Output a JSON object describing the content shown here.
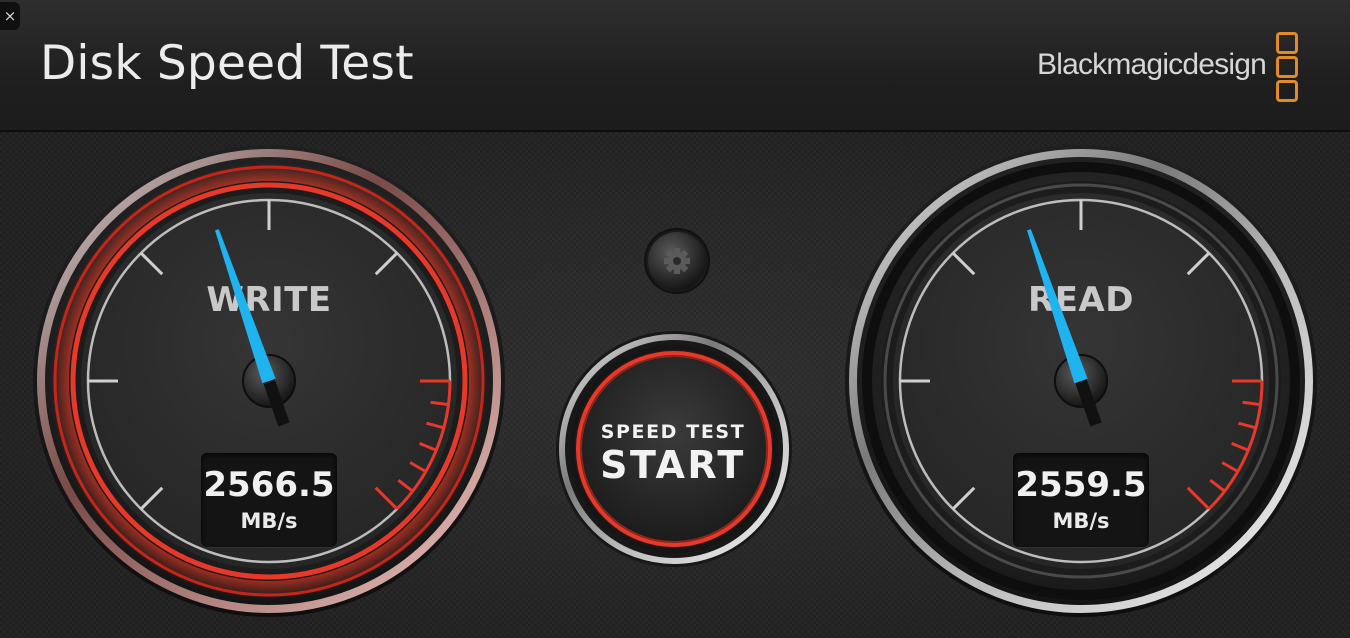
{
  "window": {
    "close_icon": "close-icon",
    "close_glyph": "×"
  },
  "header": {
    "title": "Disk Speed Test",
    "brand": "Blackmagicdesign",
    "brand_color": "#e08a2c"
  },
  "settings": {
    "icon": "gear-icon"
  },
  "start_button": {
    "line1": "SPEED TEST",
    "line2": "START",
    "ring_color": "#e23a2a"
  },
  "gauges": {
    "write": {
      "label": "WRITE",
      "value": "2566.5",
      "unit": "MB/s",
      "needle_color": "#1fb4f0",
      "active_ring_color": "#e23a2a"
    },
    "read": {
      "label": "READ",
      "value": "2559.5",
      "unit": "MB/s",
      "needle_color": "#1fb4f0"
    }
  }
}
